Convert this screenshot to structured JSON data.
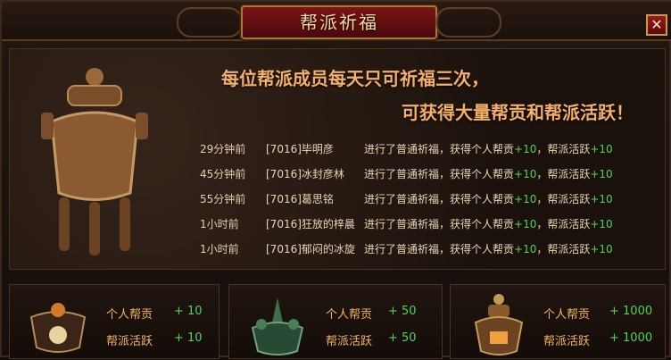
{
  "window": {
    "title": "帮派祈福",
    "close_label": "✕"
  },
  "headline": {
    "line1": "每位帮派成员每天只可祈福三次，",
    "line2": "可获得大量帮贡和帮派活跃！"
  },
  "log": [
    {
      "time": "29分钟前",
      "guild": "[7016]毕明彦",
      "action": "进行了普通祈福，获得个人帮贡",
      "contrib": "+10",
      "activity_label": "，帮派活跃",
      "activity": "+10"
    },
    {
      "time": "45分钟前",
      "guild": "[7016]冰封彦林",
      "action": "进行了普通祈福，获得个人帮贡",
      "contrib": "+10",
      "activity_label": "，帮派活跃",
      "activity": "+10"
    },
    {
      "time": "55分钟前",
      "guild": "[7016]葛思铭",
      "action": "进行了普通祈福，获得个人帮贡",
      "contrib": "+10",
      "activity_label": "，帮派活跃",
      "activity": "+10"
    },
    {
      "time": "1小时前",
      "guild": "[7016]狂放的梓晨",
      "action": "进行了普通祈福，获得个人帮贡",
      "contrib": "+10",
      "activity_label": "，帮派活跃",
      "activity": "+10"
    },
    {
      "time": "1小时前",
      "guild": "[7016]郁闷的冰旋",
      "action": "进行了普通祈福，获得个人帮贡",
      "contrib": "+10",
      "activity_label": "，帮派活跃",
      "activity": "+10"
    }
  ],
  "options": [
    {
      "label1": "个人帮贡",
      "val1": "+ 10",
      "label2": "帮派活跃",
      "val2": "+ 10"
    },
    {
      "label1": "个人帮贡",
      "val1": "+ 50",
      "label2": "帮派活跃",
      "val2": "+ 50"
    },
    {
      "label1": "个人帮贡",
      "val1": "+ 1000",
      "label2": "帮派活跃",
      "val2": "+ 1000"
    }
  ],
  "colors": {
    "accent": "#f5b06a",
    "bonus": "#55d255",
    "frame": "#a77a3a"
  },
  "icons": {
    "main": "bronze-censer-icon",
    "option1": "small-censer-icon",
    "option2": "jade-censer-icon",
    "option3": "golden-censer-icon"
  }
}
